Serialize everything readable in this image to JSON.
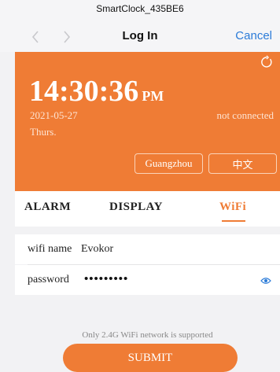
{
  "header": {
    "device_title": "SmartClock_435BE6",
    "title": "Log In",
    "cancel_label": "Cancel"
  },
  "clock": {
    "time": "14:30:36",
    "ampm": "PM",
    "date": "2021-05-27",
    "weekday": "Thurs.",
    "connection_status": "not connected",
    "city": "Guangzhou",
    "language": "中文"
  },
  "tabs": [
    {
      "label": "ALARM",
      "active": false
    },
    {
      "label": "DISPLAY",
      "active": false
    },
    {
      "label": "WiFi",
      "active": true
    }
  ],
  "wifi": {
    "name_label": "wifi name",
    "name_value": "Evokor",
    "password_label": "password",
    "password_value": "•••••••••",
    "notice": "Only 2.4G WiFi network is supported",
    "submit_label": "SUBMIT"
  },
  "colors": {
    "accent": "#ef7c35",
    "link": "#2b7bd8",
    "background": "#f2f2f4"
  },
  "icons": {
    "back": "chevron-left-icon",
    "forward": "chevron-right-icon",
    "refresh": "refresh-icon",
    "show_password": "eye-icon"
  }
}
